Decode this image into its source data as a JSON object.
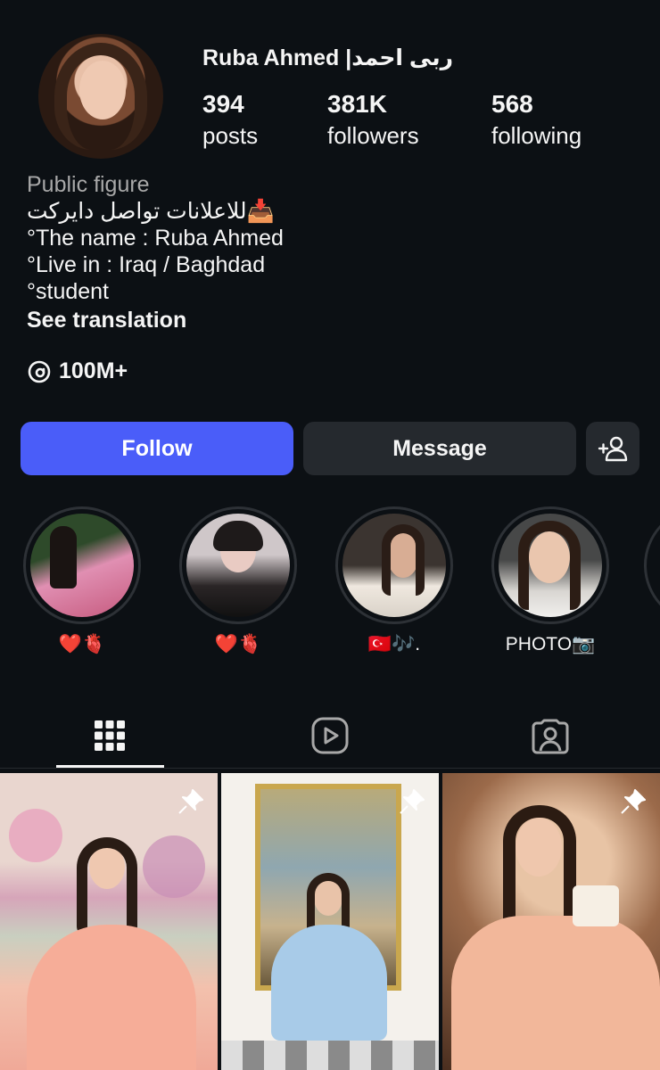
{
  "profile": {
    "username": "Ruba Ahmed |ربى احمد",
    "stats": [
      {
        "value": "394",
        "label": "posts"
      },
      {
        "value": "381K",
        "label": "followers"
      },
      {
        "value": "568",
        "label": "following"
      }
    ],
    "category": "Public figure",
    "bio_lines": [
      "📥للاعلانات تواصل دايركت",
      "°The name : Ruba Ahmed",
      "°Live in : Iraq / Baghdad",
      "°student"
    ],
    "see_translation": "See translation",
    "threads_count": "100M+"
  },
  "actions": {
    "follow_label": "Follow",
    "message_label": "Message",
    "add_user_icon": "add-user-icon"
  },
  "highlights": [
    {
      "label": "❤️🫀"
    },
    {
      "label": "❤️🫀"
    },
    {
      "label": "🇹🇷🎶."
    },
    {
      "label": "PHOTO📷"
    }
  ],
  "tabs": [
    {
      "name": "posts-grid",
      "icon": "grid-icon",
      "active": true
    },
    {
      "name": "reels",
      "icon": "reels-icon",
      "active": false
    },
    {
      "name": "tagged",
      "icon": "tagged-icon",
      "active": false
    }
  ],
  "colors": {
    "background": "#0c1014",
    "follow_button": "#4a5df9",
    "secondary_button": "#25292e",
    "muted_text": "#a8a8a8"
  }
}
